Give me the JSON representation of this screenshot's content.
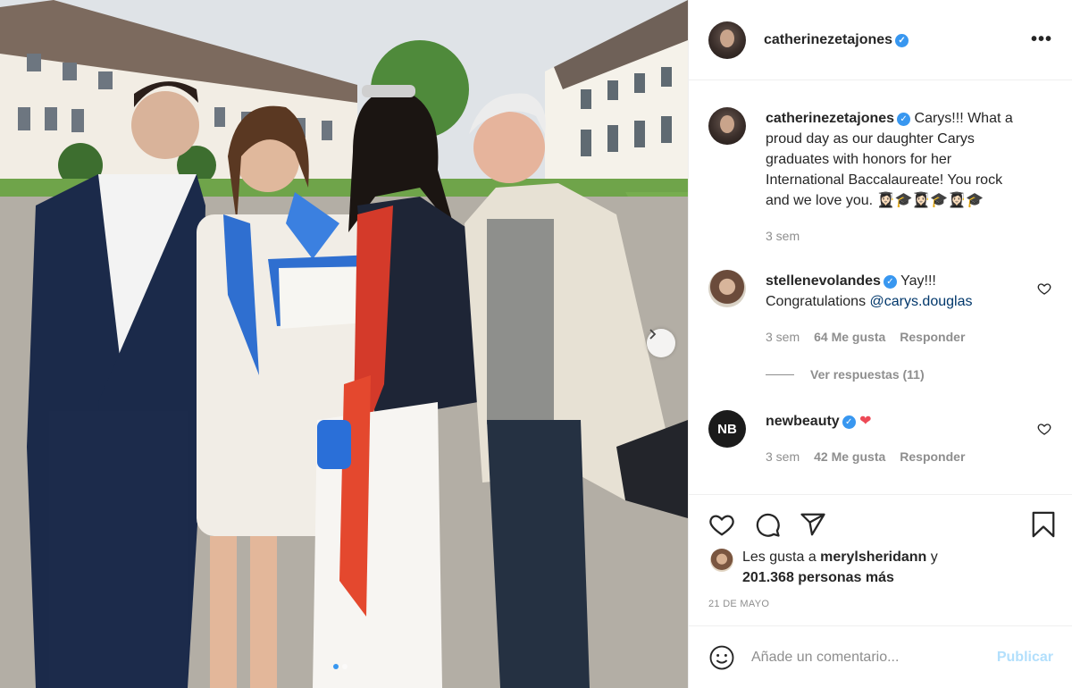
{
  "post": {
    "username": "catherinezetajones",
    "more_icon": "more-horizontal-icon"
  },
  "caption": {
    "username": "catherinezetajones",
    "text": "Carys!!! What a proud day as our daughter Carys graduates with honors for her International Baccalaureate! You rock and we love you. 👩🏻‍🎓🎓👩🏻‍🎓🎓👩🏻‍🎓🎓",
    "time": "3 sem"
  },
  "comments": [
    {
      "username": "stellenevolandes",
      "text": "Yay!!! Congratulations ",
      "mention": "@carys.douglas",
      "time": "3 sem",
      "likes": "64 Me gusta",
      "reply": "Responder",
      "view_replies": "Ver respuestas (11)"
    },
    {
      "username": "newbeauty",
      "avatar_text": "NB",
      "text": "❤",
      "time": "3 sem",
      "likes": "42 Me gusta",
      "reply": "Responder"
    }
  ],
  "likes": {
    "prefix": "Les gusta a ",
    "user": "merylsheridann",
    "suffix": " y",
    "others": "201.368 personas más"
  },
  "date": "21 DE MAYO",
  "comment_box": {
    "placeholder": "Añade un comentario...",
    "post_label": "Publicar"
  },
  "colors": {
    "accent": "#3897f0",
    "publish_disabled": "#b2dffc",
    "heart": "#ed4956"
  }
}
